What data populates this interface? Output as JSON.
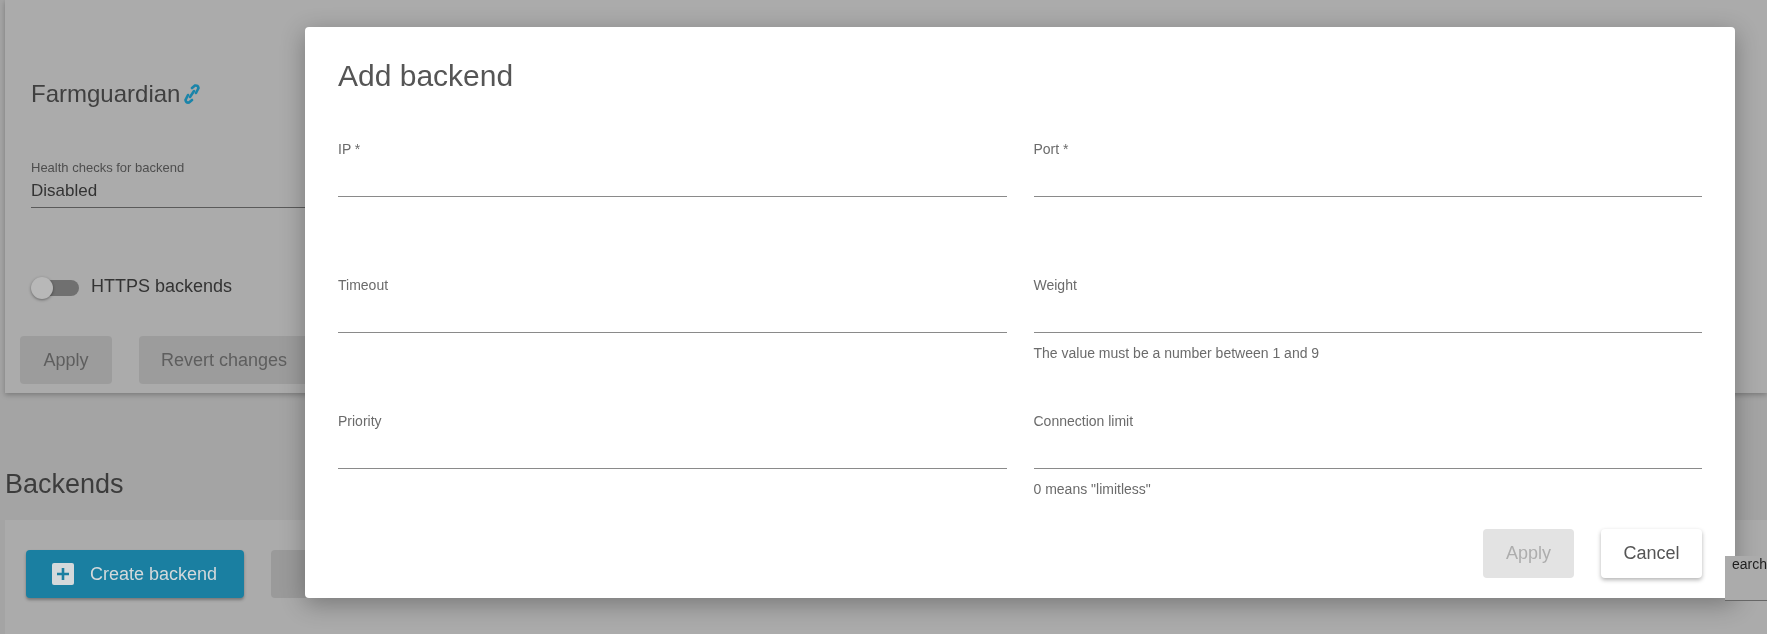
{
  "settings_card": {
    "title": "Farmguardian",
    "health_check": {
      "label": "Health checks for backend",
      "value": "Disabled"
    },
    "https_toggle": {
      "label": "HTTPS backends",
      "on": false
    },
    "buttons": [
      {
        "label": "Apply",
        "disabled": true
      },
      {
        "label": "Revert changes",
        "disabled": true
      }
    ]
  },
  "backends": {
    "heading": "Backends",
    "create_button": "Create backend",
    "search_placeholder": "earch"
  },
  "dialog": {
    "title": "Add backend",
    "fields": [
      {
        "label": "IP *"
      },
      {
        "label": "Port *"
      },
      {
        "label": "Timeout"
      },
      {
        "label": "Weight",
        "hint": "The value must be a number between 1 and 9"
      },
      {
        "label": "Priority"
      },
      {
        "label": "Connection limit",
        "hint": "0 means \"limitless\""
      }
    ],
    "buttons": [
      {
        "label": "Apply",
        "disabled": true
      },
      {
        "label": "Cancel",
        "disabled": false
      }
    ]
  }
}
